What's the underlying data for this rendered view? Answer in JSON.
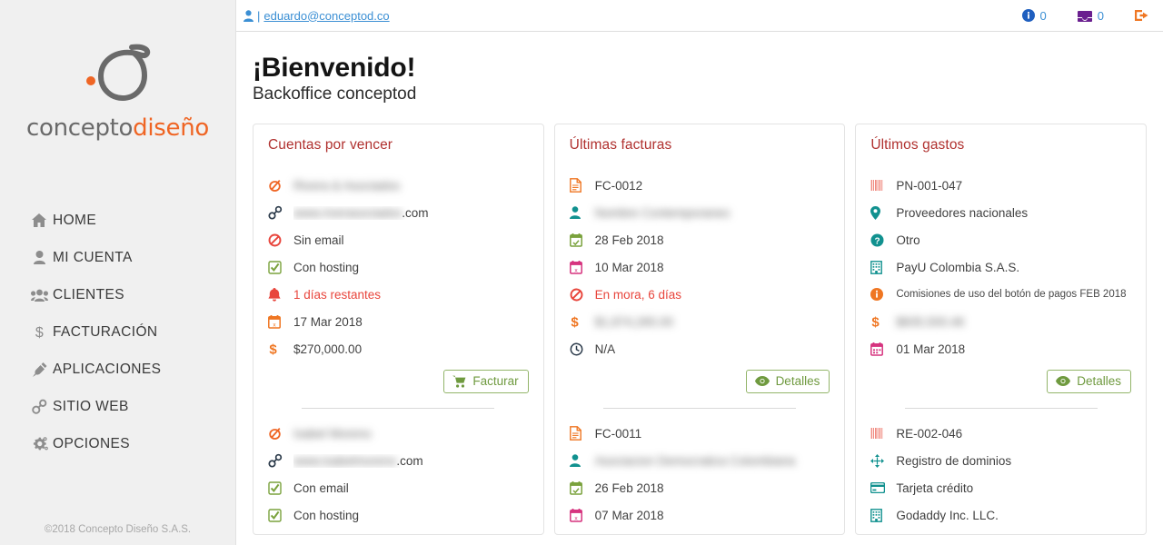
{
  "brand": {
    "logo_text_primary": "concepto",
    "logo_text_accent": "diseño",
    "primary_color": "#6a6a6a",
    "accent_color": "#ef6524",
    "copyright": "©2018 Concepto Diseño S.A.S."
  },
  "topbar": {
    "user_icon": "user-icon",
    "separator": "|",
    "email": "eduardo@conceptod.co",
    "link_color": "#3b8fd4",
    "notifications": {
      "icon": "info-circle-icon",
      "count": "0",
      "color": "#1f5fbf"
    },
    "messages": {
      "icon": "inbox-icon",
      "count": "0",
      "color": "#6a1f8f"
    },
    "logout": {
      "icon": "sign-out-icon",
      "color": "#ef7622"
    }
  },
  "sidebar": {
    "items": [
      {
        "label": "HOME",
        "icon": "home-icon"
      },
      {
        "label": "MI CUENTA",
        "icon": "user-icon"
      },
      {
        "label": "CLIENTES",
        "icon": "users-icon"
      },
      {
        "label": "FACTURACIÓN",
        "icon": "dollar-icon"
      },
      {
        "label": "APLICACIONES",
        "icon": "plug-icon"
      },
      {
        "label": "SITIO WEB",
        "icon": "chain-icon"
      },
      {
        "label": "OPCIONES",
        "icon": "cogs-icon"
      }
    ]
  },
  "page": {
    "title": "¡Bienvenido!",
    "subtitle": "Backoffice conceptod"
  },
  "cards": [
    {
      "title": "Cuentas por vencer",
      "title_color": "#b0312f",
      "entries": [
        {
          "rows": [
            {
              "icon": "circle-slash-icon",
              "icon_color": "#ef6524",
              "text": "Rivera & Asociados",
              "blurred": true
            },
            {
              "icon": "chain-icon",
              "icon_color": "#2b3a4a",
              "text": "www.riverasociados.com",
              "blurred": true,
              "suffix": ".com"
            },
            {
              "icon": "ban-icon",
              "icon_color": "#e8453c",
              "text": "Sin email",
              "blurred": false
            },
            {
              "icon": "check-square-icon",
              "icon_color": "#7aa23d",
              "text": "Con hosting",
              "blurred": false
            },
            {
              "icon": "bell-icon",
              "icon_color": "#e8453c",
              "text": "1 días restantes",
              "blurred": false,
              "danger": true
            },
            {
              "icon": "calendar-times-icon",
              "icon_color": "#ef7622",
              "text": "17 Mar 2018",
              "blurred": false
            },
            {
              "icon": "dollar-icon",
              "icon_color": "#ef7622",
              "text": "$270,000.00",
              "blurred": false
            }
          ],
          "button": {
            "label": "Facturar",
            "icon": "shopping-cart-icon"
          }
        },
        {
          "rows": [
            {
              "icon": "circle-slash-icon",
              "icon_color": "#ef6524",
              "text": "Isabel Moreno",
              "blurred": true
            },
            {
              "icon": "chain-icon",
              "icon_color": "#2b3a4a",
              "text": "www.isabelmoreno.com",
              "blurred": true,
              "suffix": ".com"
            },
            {
              "icon": "check-square-icon",
              "icon_color": "#7aa23d",
              "text": "Con email",
              "blurred": false
            },
            {
              "icon": "check-square-icon",
              "icon_color": "#7aa23d",
              "text": "Con hosting",
              "blurred": false
            }
          ]
        }
      ]
    },
    {
      "title": "Últimas facturas",
      "title_color": "#b0312f",
      "entries": [
        {
          "rows": [
            {
              "icon": "file-icon",
              "icon_color": "#ef7622",
              "text": "FC-0012",
              "blurred": false
            },
            {
              "icon": "user-icon",
              "icon_color": "#11918f",
              "text": "Nombre Contemporaneo",
              "blurred": true
            },
            {
              "icon": "calendar-check-icon",
              "icon_color": "#7aa23d",
              "text": "28 Feb 2018",
              "blurred": false
            },
            {
              "icon": "calendar-times-icon",
              "icon_color": "#d6347f",
              "text": "10 Mar 2018",
              "blurred": false
            },
            {
              "icon": "ban-icon",
              "icon_color": "#e8453c",
              "text": "En mora, 6 días",
              "blurred": false,
              "danger": true
            },
            {
              "icon": "dollar-icon",
              "icon_color": "#ef7622",
              "text": "$1,874,265.00",
              "blurred": true
            },
            {
              "icon": "clock-icon",
              "icon_color": "#2b3a4a",
              "text": "N/A",
              "blurred": false
            }
          ],
          "button": {
            "label": "Detalles",
            "icon": "eye-icon"
          }
        },
        {
          "rows": [
            {
              "icon": "file-icon",
              "icon_color": "#ef7622",
              "text": "FC-0011",
              "blurred": false
            },
            {
              "icon": "user-icon",
              "icon_color": "#11918f",
              "text": "Asociacion Democratica Colombiana",
              "blurred": true
            },
            {
              "icon": "calendar-check-icon",
              "icon_color": "#7aa23d",
              "text": "26 Feb 2018",
              "blurred": false
            },
            {
              "icon": "calendar-times-icon",
              "icon_color": "#d6347f",
              "text": "07 Mar 2018",
              "blurred": false
            }
          ]
        }
      ]
    },
    {
      "title": "Últimos gastos",
      "title_color": "#b0312f",
      "entries": [
        {
          "rows": [
            {
              "icon": "barcode-icon",
              "icon_color": "#f08a80",
              "text": "PN-001-047",
              "blurred": false
            },
            {
              "icon": "map-marker-icon",
              "icon_color": "#11918f",
              "text": "Proveedores nacionales",
              "blurred": false
            },
            {
              "icon": "question-circle-icon",
              "icon_color": "#11918f",
              "text": "Otro",
              "blurred": false
            },
            {
              "icon": "building-icon",
              "icon_color": "#11918f",
              "text": "PayU Colombia S.A.S.",
              "blurred": false
            },
            {
              "icon": "info-circle-icon",
              "icon_color": "#ef7622",
              "text": "Comisiones de uso del botón de pagos FEB 2018",
              "blurred": false,
              "small": true
            },
            {
              "icon": "dollar-icon",
              "icon_color": "#ef7622",
              "text": "$835,500.46",
              "blurred": true
            },
            {
              "icon": "calendar-icon",
              "icon_color": "#d6347f",
              "text": "01 Mar 2018",
              "blurred": false
            }
          ],
          "button": {
            "label": "Detalles",
            "icon": "eye-icon"
          }
        },
        {
          "rows": [
            {
              "icon": "barcode-icon",
              "icon_color": "#f08a80",
              "text": "RE-002-046",
              "blurred": false
            },
            {
              "icon": "arrows-icon",
              "icon_color": "#11918f",
              "text": "Registro de dominios",
              "blurred": false
            },
            {
              "icon": "credit-card-icon",
              "icon_color": "#11918f",
              "text": "Tarjeta crédito",
              "blurred": false
            },
            {
              "icon": "building-icon",
              "icon_color": "#11918f",
              "text": "Godaddy Inc. LLC.",
              "blurred": false
            }
          ]
        }
      ]
    }
  ]
}
